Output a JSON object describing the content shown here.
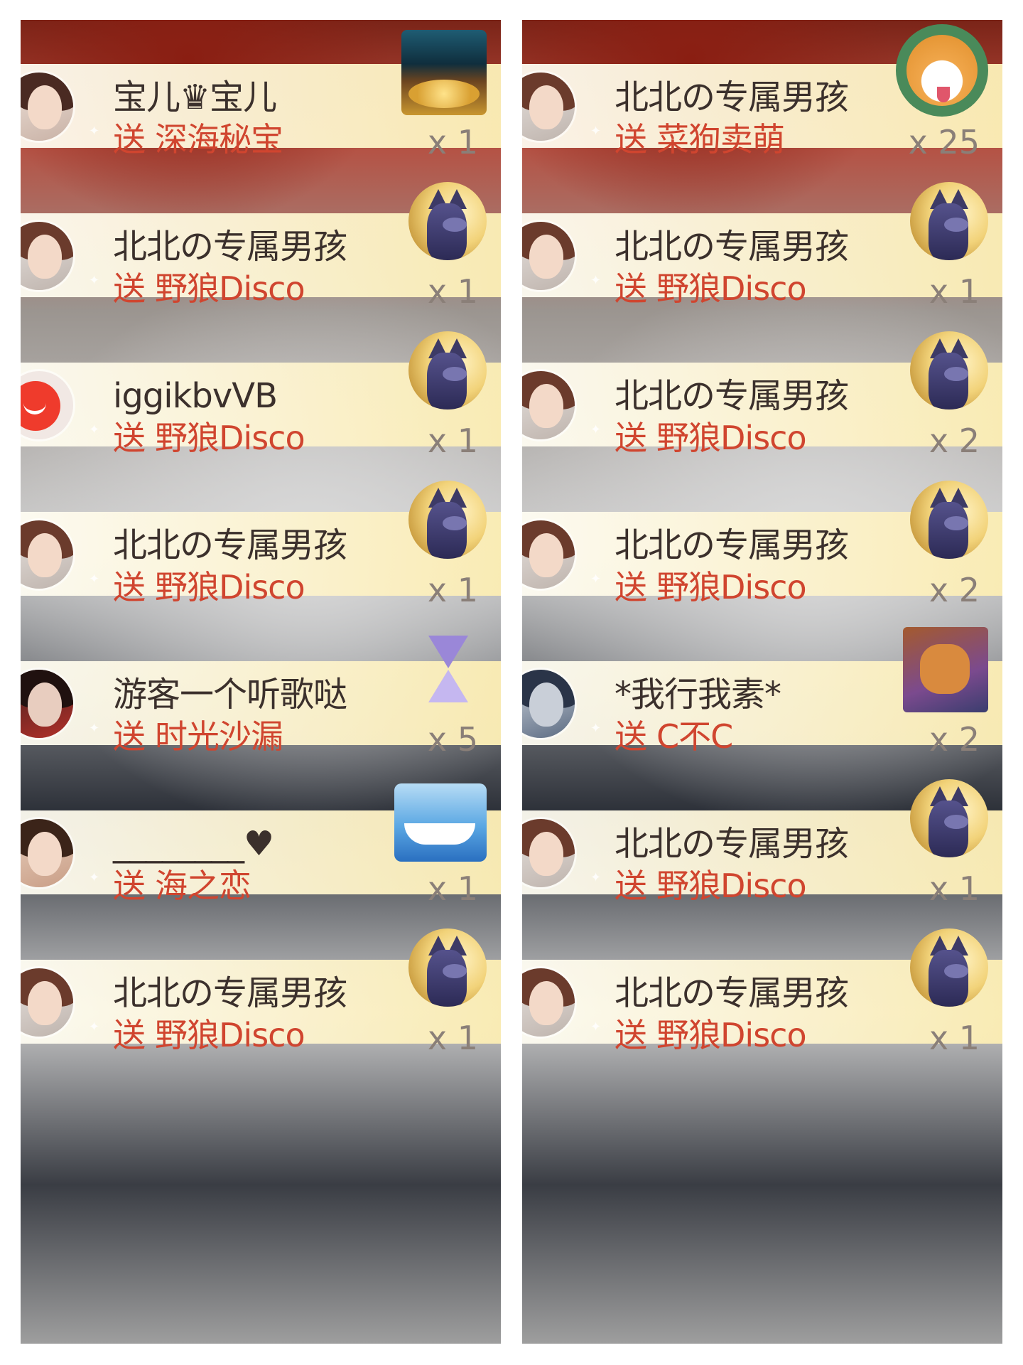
{
  "columns": [
    {
      "id": "left",
      "entries": [
        {
          "avatar": "girl",
          "gift_icon": "treasure-chest",
          "name": "宝儿♛宝儿",
          "send": "送",
          "gift": "深海秘宝",
          "count": "x 1"
        },
        {
          "avatar": "fair",
          "gift_icon": "wolf",
          "name": "北北の专属男孩",
          "send": "送",
          "gift": "野狼Disco",
          "count": "x 1"
        },
        {
          "avatar": "red",
          "gift_icon": "wolf",
          "name": "iggikbvVB",
          "send": "送",
          "gift": "野狼Disco",
          "count": "x 1"
        },
        {
          "avatar": "fair",
          "gift_icon": "wolf",
          "name": "北北の专属男孩",
          "send": "送",
          "gift": "野狼Disco",
          "count": "x 1"
        },
        {
          "avatar": "dark",
          "gift_icon": "hourglass",
          "name": "游客一个听歌哒",
          "send": "送",
          "gift": "时光沙漏",
          "count": "x 5"
        },
        {
          "avatar": "baby",
          "gift_icon": "ship",
          "name": "________♥",
          "send": "送",
          "gift": "海之恋",
          "count": "x 1"
        },
        {
          "avatar": "fair",
          "gift_icon": "wolf",
          "name": "北北の专属男孩",
          "send": "送",
          "gift": "野狼Disco",
          "count": "x 1"
        }
      ]
    },
    {
      "id": "right",
      "entries": [
        {
          "avatar": "fair",
          "gift_icon": "shiba-dog",
          "name": "北北の专属男孩",
          "send": "送",
          "gift": "菜狗卖萌",
          "count": "x 25"
        },
        {
          "avatar": "fair",
          "gift_icon": "wolf",
          "name": "北北の专属男孩",
          "send": "送",
          "gift": "野狼Disco",
          "count": "x 1"
        },
        {
          "avatar": "fair",
          "gift_icon": "wolf",
          "name": "北北の专属男孩",
          "send": "送",
          "gift": "野狼Disco",
          "count": "x 2"
        },
        {
          "avatar": "fair",
          "gift_icon": "wolf",
          "name": "北北の专属男孩",
          "send": "送",
          "gift": "野狼Disco",
          "count": "x 2"
        },
        {
          "avatar": "ink",
          "gift_icon": "cat-figure",
          "name": "*我行我素*",
          "send": "送",
          "gift": "C不C",
          "count": "x 2"
        },
        {
          "avatar": "fair",
          "gift_icon": "wolf",
          "name": "北北の专属男孩",
          "send": "送",
          "gift": "野狼Disco",
          "count": "x 1"
        },
        {
          "avatar": "fair",
          "gift_icon": "wolf",
          "name": "北北の专属男孩",
          "send": "送",
          "gift": "野狼Disco",
          "count": "x 1"
        }
      ]
    }
  ],
  "colors": {
    "name_text": "#3b302c",
    "gift_text": "#d0452f",
    "count_text": "#8a7f78",
    "band": "#fcf3d0"
  }
}
